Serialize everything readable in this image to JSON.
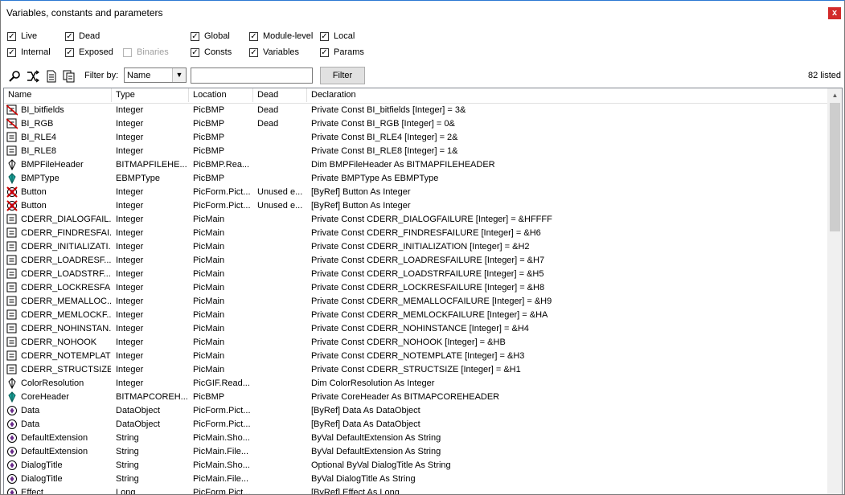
{
  "window": {
    "title": "Variables, constants and parameters",
    "close_glyph": "x"
  },
  "options": {
    "live": "Live",
    "dead": "Dead",
    "binaries": "Binaries",
    "global": "Global",
    "module_level": "Module-level",
    "local": "Local",
    "internal": "Internal",
    "exposed": "Exposed",
    "consts": "Consts",
    "variables": "Variables",
    "params": "Params"
  },
  "toolbar": {
    "filter_by_label": "Filter by:",
    "filter_select_value": "Name",
    "filter_input_value": "",
    "filter_button": "Filter",
    "count": "82 listed"
  },
  "columns": [
    "Name",
    "Type",
    "Location",
    "Dead",
    "Declaration"
  ],
  "rows": [
    {
      "icon": "dead-const",
      "name": "BI_bitfields",
      "type": "Integer",
      "location": "PicBMP",
      "dead": "Dead",
      "decl": "Private Const BI_bitfields [Integer] = 3&"
    },
    {
      "icon": "dead-const",
      "name": "BI_RGB",
      "type": "Integer",
      "location": "PicBMP",
      "dead": "Dead",
      "decl": "Private Const BI_RGB [Integer] = 0&"
    },
    {
      "icon": "const",
      "name": "BI_RLE4",
      "type": "Integer",
      "location": "PicBMP",
      "dead": "",
      "decl": "Private Const BI_RLE4 [Integer] = 2&"
    },
    {
      "icon": "const",
      "name": "BI_RLE8",
      "type": "Integer",
      "location": "PicBMP",
      "dead": "",
      "decl": "Private Const BI_RLE8 [Integer] = 1&"
    },
    {
      "icon": "var",
      "name": "BMPFileHeader",
      "type": "BITMAPFILEHE...",
      "location": "PicBMP.Rea...",
      "dead": "",
      "decl": "Dim BMPFileHeader As BITMAPFILEHEADER"
    },
    {
      "icon": "module-var",
      "name": "BMPType",
      "type": "EBMPType",
      "location": "PicBMP",
      "dead": "",
      "decl": "Private BMPType As EBMPType"
    },
    {
      "icon": "unused-param",
      "name": "Button",
      "type": "Integer",
      "location": "PicForm.Pict...",
      "dead": "Unused e...",
      "decl": "[ByRef] Button As Integer"
    },
    {
      "icon": "unused-param",
      "name": "Button",
      "type": "Integer",
      "location": "PicForm.Pict...",
      "dead": "Unused e...",
      "decl": "[ByRef] Button As Integer"
    },
    {
      "icon": "const",
      "name": "CDERR_DIALOGFAIL...",
      "type": "Integer",
      "location": "PicMain",
      "dead": "",
      "decl": "Private Const CDERR_DIALOGFAILURE [Integer] = &HFFFF"
    },
    {
      "icon": "const",
      "name": "CDERR_FINDRESFAI...",
      "type": "Integer",
      "location": "PicMain",
      "dead": "",
      "decl": "Private Const CDERR_FINDRESFAILURE [Integer] = &H6"
    },
    {
      "icon": "const",
      "name": "CDERR_INITIALIZATI...",
      "type": "Integer",
      "location": "PicMain",
      "dead": "",
      "decl": "Private Const CDERR_INITIALIZATION [Integer] = &H2"
    },
    {
      "icon": "const",
      "name": "CDERR_LOADRESF...",
      "type": "Integer",
      "location": "PicMain",
      "dead": "",
      "decl": "Private Const CDERR_LOADRESFAILURE [Integer] = &H7"
    },
    {
      "icon": "const",
      "name": "CDERR_LOADSTRF...",
      "type": "Integer",
      "location": "PicMain",
      "dead": "",
      "decl": "Private Const CDERR_LOADSTRFAILURE [Integer] = &H5"
    },
    {
      "icon": "const",
      "name": "CDERR_LOCKRESFA...",
      "type": "Integer",
      "location": "PicMain",
      "dead": "",
      "decl": "Private Const CDERR_LOCKRESFAILURE [Integer] = &H8"
    },
    {
      "icon": "const",
      "name": "CDERR_MEMALLOC...",
      "type": "Integer",
      "location": "PicMain",
      "dead": "",
      "decl": "Private Const CDERR_MEMALLOCFAILURE [Integer] = &H9"
    },
    {
      "icon": "const",
      "name": "CDERR_MEMLOCKF...",
      "type": "Integer",
      "location": "PicMain",
      "dead": "",
      "decl": "Private Const CDERR_MEMLOCKFAILURE [Integer] = &HA"
    },
    {
      "icon": "const",
      "name": "CDERR_NOHINSTAN...",
      "type": "Integer",
      "location": "PicMain",
      "dead": "",
      "decl": "Private Const CDERR_NOHINSTANCE [Integer] = &H4"
    },
    {
      "icon": "const",
      "name": "CDERR_NOHOOK",
      "type": "Integer",
      "location": "PicMain",
      "dead": "",
      "decl": "Private Const CDERR_NOHOOK [Integer] = &HB"
    },
    {
      "icon": "const",
      "name": "CDERR_NOTEMPLATE",
      "type": "Integer",
      "location": "PicMain",
      "dead": "",
      "decl": "Private Const CDERR_NOTEMPLATE [Integer] = &H3"
    },
    {
      "icon": "const",
      "name": "CDERR_STRUCTSIZE",
      "type": "Integer",
      "location": "PicMain",
      "dead": "",
      "decl": "Private Const CDERR_STRUCTSIZE [Integer] = &H1"
    },
    {
      "icon": "var",
      "name": "ColorResolution",
      "type": "Integer",
      "location": "PicGIF.Read...",
      "dead": "",
      "decl": "Dim ColorResolution As Integer"
    },
    {
      "icon": "module-var",
      "name": "CoreHeader",
      "type": "BITMAPCOREH...",
      "location": "PicBMP",
      "dead": "",
      "decl": "Private CoreHeader As BITMAPCOREHEADER"
    },
    {
      "icon": "param",
      "name": "Data",
      "type": "DataObject",
      "location": "PicForm.Pict...",
      "dead": "",
      "decl": "[ByRef] Data As DataObject"
    },
    {
      "icon": "param",
      "name": "Data",
      "type": "DataObject",
      "location": "PicForm.Pict...",
      "dead": "",
      "decl": "[ByRef] Data As DataObject"
    },
    {
      "icon": "param",
      "name": "DefaultExtension",
      "type": "String",
      "location": "PicMain.Sho...",
      "dead": "",
      "decl": "ByVal DefaultExtension As String"
    },
    {
      "icon": "param",
      "name": "DefaultExtension",
      "type": "String",
      "location": "PicMain.File...",
      "dead": "",
      "decl": "ByVal DefaultExtension As String"
    },
    {
      "icon": "param",
      "name": "DialogTitle",
      "type": "String",
      "location": "PicMain.Sho...",
      "dead": "",
      "decl": "Optional ByVal DialogTitle As String"
    },
    {
      "icon": "param",
      "name": "DialogTitle",
      "type": "String",
      "location": "PicMain.File...",
      "dead": "",
      "decl": "ByVal DialogTitle As String"
    },
    {
      "icon": "param",
      "name": "Effect",
      "type": "Long",
      "location": "PicForm.Pict...",
      "dead": "",
      "decl": "[ByRef] Effect As Long"
    }
  ],
  "colors": {
    "titlebar_border": "#2b79d3",
    "close_red": "#d22b2b",
    "dead_red": "#cc0000",
    "param_purple": "#6a2a8a",
    "module_teal": "#1aa39a"
  }
}
